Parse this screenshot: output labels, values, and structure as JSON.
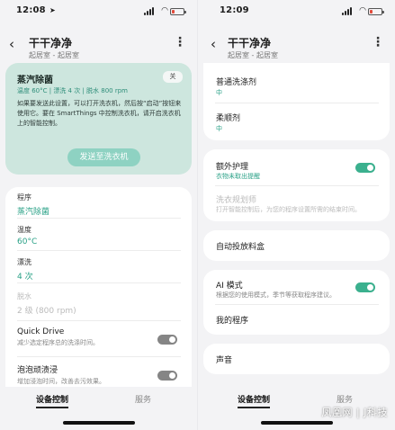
{
  "status_left": {
    "time": "12:08"
  },
  "status_right": {
    "time": "12:09"
  },
  "header": {
    "title": "干干净净",
    "subtitle": "起居室 - 起居室",
    "back_icon": "chevron-left-icon",
    "more_icon": "more-vertical-icon"
  },
  "recommendation": {
    "title": "蒸汽除菌",
    "specs": "温度 60°C  |  漂洗 4 次  |  脱水 800 rpm",
    "desc": "如果要发送此设置，可以打开洗衣机，然后按“启动”按钮来使用它。要在 SmartThings 中控制洗衣机，请开启洗衣机上的智能控制。",
    "tag": "关",
    "send_label": "发送至洗衣机"
  },
  "settings": {
    "program_label": "程序",
    "program_value": "蒸汽除菌",
    "temp_label": "温度",
    "temp_value": "60°C",
    "rinse_label": "漂洗",
    "rinse_value": "4 次",
    "spin_label": "脱水",
    "spin_value": "2 级 (800 rpm)",
    "quickdrive_label": "Quick Drive",
    "quickdrive_desc": "减少选定程序总的洗涤时间。",
    "quickdrive_on": false,
    "bubble_label": "泡泡顽渍浸",
    "bubble_desc": "增加浸泡时间，改善去污效果。",
    "bubble_on": false
  },
  "detergent": {
    "normal_label": "普通洗涤剂",
    "normal_value": "中",
    "softener_label": "柔顺剂",
    "softener_value": "中"
  },
  "extra_care": {
    "label": "额外护理",
    "desc": "衣物未取出提醒",
    "on": true
  },
  "laundry_planner": {
    "label": "洗衣规划师",
    "desc": "打开智能控制后，为您的程序设置所需的结束时间。"
  },
  "auto_dispense": {
    "label": "自动投放料盒"
  },
  "ai_mode": {
    "label": "AI 模式",
    "desc": "根据您的使用模式，季节等获取程序建议。",
    "on": true
  },
  "my_programs": {
    "label": "我的程序"
  },
  "sound": {
    "label": "声音"
  },
  "tabs": {
    "device_control": "设备控制",
    "services": "服务"
  },
  "watermark": "凤凰网 | J科技",
  "colors": {
    "accent": "#2aa187",
    "card": "#cde6de",
    "toggle_on": "#3bb08e"
  }
}
